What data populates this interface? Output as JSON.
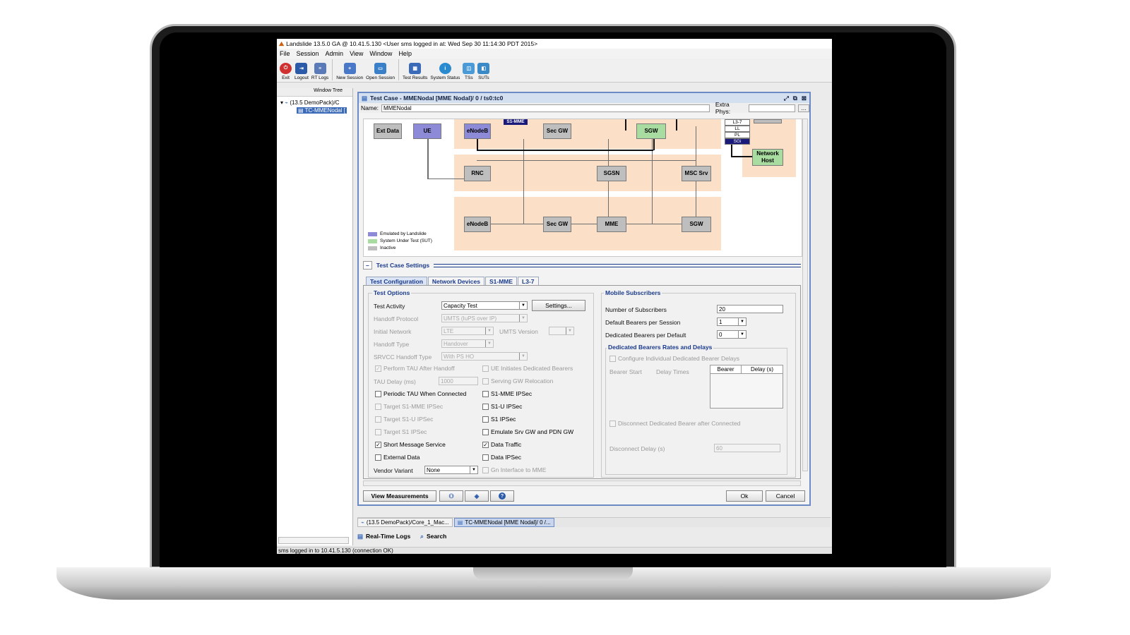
{
  "app": {
    "title": "Landslide 13.5.0  GA  @ 10.41.5.130 <User sms logged in at:  Wed Sep 30 11:14:30 PDT 2015>"
  },
  "menu": [
    "File",
    "Session",
    "Admin",
    "View",
    "Window",
    "Help"
  ],
  "toolbar": [
    {
      "label": "Exit",
      "icon": "exit-icon",
      "color": "#d03030"
    },
    {
      "label": "Logout",
      "icon": "logout-icon",
      "color": "#2a5aa8"
    },
    {
      "label": "RT Logs",
      "icon": "rt-logs-icon",
      "color": "#5a7ab8"
    },
    {
      "label": "New Session",
      "icon": "new-session-icon",
      "color": "#4a78c8"
    },
    {
      "label": "Open Session",
      "icon": "open-session-icon",
      "color": "#3a80c8"
    },
    {
      "label": "Test Results",
      "icon": "test-results-icon",
      "color": "#3a6ab8"
    },
    {
      "label": "System Status",
      "icon": "system-status-icon",
      "color": "#2a8ad0"
    },
    {
      "label": "TSs",
      "icon": "ts-icon",
      "color": "#4a9ad8"
    },
    {
      "label": "SUTs",
      "icon": "sut-icon",
      "color": "#3a8ac8"
    }
  ],
  "tree": {
    "header": "Window Tree",
    "items": [
      "(13.5 DemoPack)/C",
      "TC-MMENodal ["
    ]
  },
  "testcase": {
    "title": "Test Case - MMENodal [MME Nodal]/ 0 / ts0:tc0",
    "name_label": "Name:",
    "name_value": "MMENodal",
    "extra_label": "Extra Phys:"
  },
  "diagram": {
    "nodes": {
      "ext": "Ext Data",
      "ue": "UE",
      "enb1": "eNodeB",
      "secgw1": "Sec GW",
      "sgw1": "SGW",
      "rnc": "RNC",
      "sgsn": "SGSN",
      "msc": "MSC Srv",
      "enb2": "eNodeB",
      "secgw2": "Sec GW",
      "mme": "MME",
      "sgw2": "SGW",
      "nethost": "Network Host",
      "s1mme": "S1-MME"
    },
    "stack": [
      "L3-7",
      "LL",
      "PL",
      "SGi"
    ],
    "legend": [
      "Emulated by Landslide",
      "System Under Test (SUT)",
      "Inactive"
    ],
    "colors": {
      "emulated": "#8d8ad8",
      "sut": "#a8dca0",
      "inactive": "#bebebe",
      "band": "#fbdfc6"
    }
  },
  "settings": {
    "header": "Test Case Settings",
    "tabs": [
      "Test Configuration",
      "Network Devices",
      "S1-MME",
      "L3-7"
    ]
  },
  "options": {
    "title": "Test Options",
    "test_activity_label": "Test Activity",
    "test_activity_value": "Capacity Test",
    "settings_button": "Settings...",
    "handoff_protocol_label": "Handoff Protocol",
    "handoff_protocol_value": "UMTS (IuPS over IP)",
    "initial_network_label": "Initial Network",
    "initial_network_value": "LTE",
    "umts_version_label": "UMTS Version",
    "handoff_type_label": "Handoff Type",
    "handoff_type_value": "Handover",
    "srvcc_label": "SRVCC Handoff Type",
    "srvcc_value": "With PS HO",
    "perform_tau": "Perform TAU After Handoff",
    "ue_initiates": "UE Initiates Dedicated Bearers",
    "tau_delay_label": "TAU Delay (ms)",
    "tau_delay_value": "1000",
    "serving_gw": "Serving GW Relocation",
    "periodic_tau": "Periodic TAU When Connected",
    "s1mme_ipsec": "S1-MME IPSec",
    "target_s1mme": "Target S1-MME IPSec",
    "s1u_ipsec": "S1-U IPSec",
    "target_s1u": "Target S1-U IPSec",
    "s1_ipsec": "S1 IPSec",
    "target_s1": "Target S1 IPSec",
    "emulate_srv": "Emulate Srv GW and PDN GW",
    "sms": "Short Message Service",
    "data_traffic": "Data Traffic",
    "external_data": "External Data",
    "data_ipsec": "Data IPSec",
    "vendor_label": "Vendor Variant",
    "vendor_value": "None",
    "gn_interface": "Gn Interface to MME"
  },
  "mobile": {
    "title": "Mobile Subscribers",
    "num_label": "Number of Subscribers",
    "num_value": "20",
    "default_label": "Default Bearers per Session",
    "default_value": "1",
    "dedicated_label": "Dedicated Bearers per Default",
    "dedicated_value": "0",
    "rates_title": "Dedicated Bearers Rates and Delays",
    "configure": "Configure Individual Dedicated Bearer Delays",
    "bearer_start": "Bearer Start",
    "delay_times": "Delay Times",
    "col_bearer": "Bearer",
    "col_delay": "Delay (s)",
    "disconnect_cb": "Disconnect Dedicated Bearer after Connected",
    "disconnect_delay_label": "Disconnect Delay (s)",
    "disconnect_delay_value": "60"
  },
  "bottom": {
    "view_measurements": "View Measurements",
    "ok": "Ok",
    "cancel": "Cancel"
  },
  "doc_tabs": [
    "(13.5 DemoPack)/Core_1_Mac...",
    "TC-MMENodal [MME Nodal]/ 0 /..."
  ],
  "status_tabs": [
    "Real-Time Logs",
    "Search"
  ],
  "status": "sms logged in to 10.41.5.130 (connection OK)"
}
